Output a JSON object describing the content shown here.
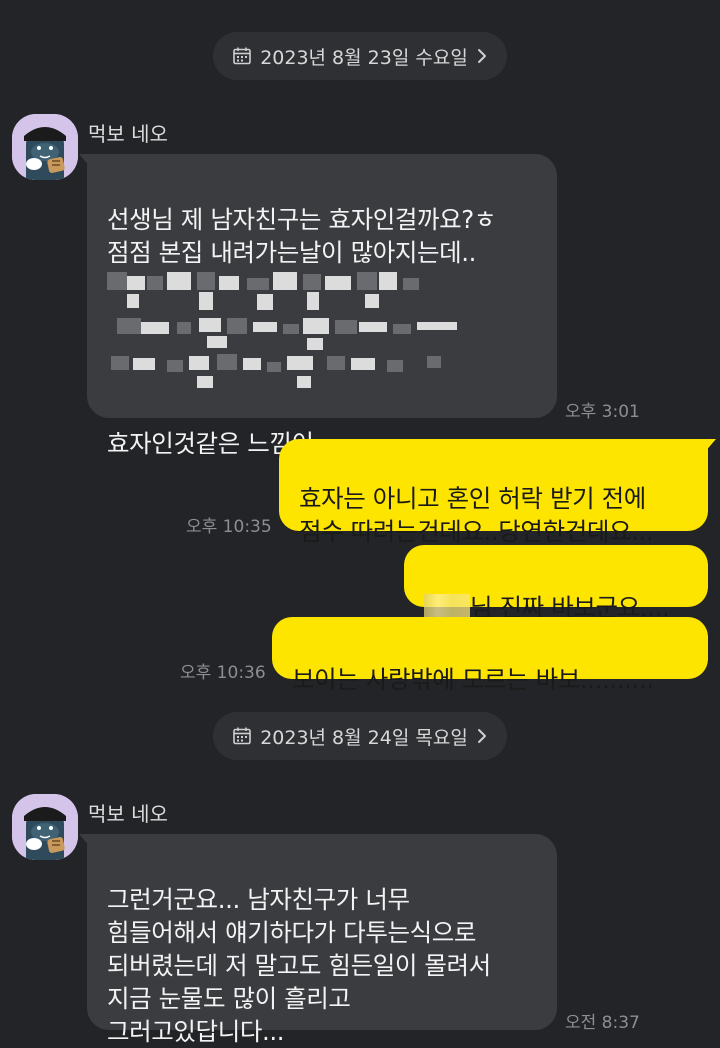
{
  "dates": [
    {
      "label": "2023년 8월 23일 수요일"
    },
    {
      "label": "2023년 8월 24일 목요일"
    }
  ],
  "messages": [
    {
      "sender": "먹보 네오",
      "line1": "선생님 제 남자친구는 효자인걸까요?ㅎ\n점점 본집 내려가는날이 많아지는데..",
      "line2": "효자인것같은 느낌이....",
      "time": "오후 3:01"
    },
    {
      "text": "효자는 아니고 혼인 허락 받기 전에\n점수 따려는건데요..당연한건데요...",
      "time": "오후 10:35"
    },
    {
      "text_suffix": "님 진짜 바보군요...."
    },
    {
      "text": "보이는 사랑밖에 모르는 바보..........",
      "time": "오후 10:36"
    },
    {
      "sender": "먹보 네오",
      "text": "그런거군요... 남자친구가 너무\n힘들어해서 얘기하다가 다투는식으로\n되버렸는데 저 말고도 힘든일이 몰려서\n지금 눈물도 많이 흘리고\n그러고있답니다...",
      "time": "오전 8:37"
    }
  ]
}
